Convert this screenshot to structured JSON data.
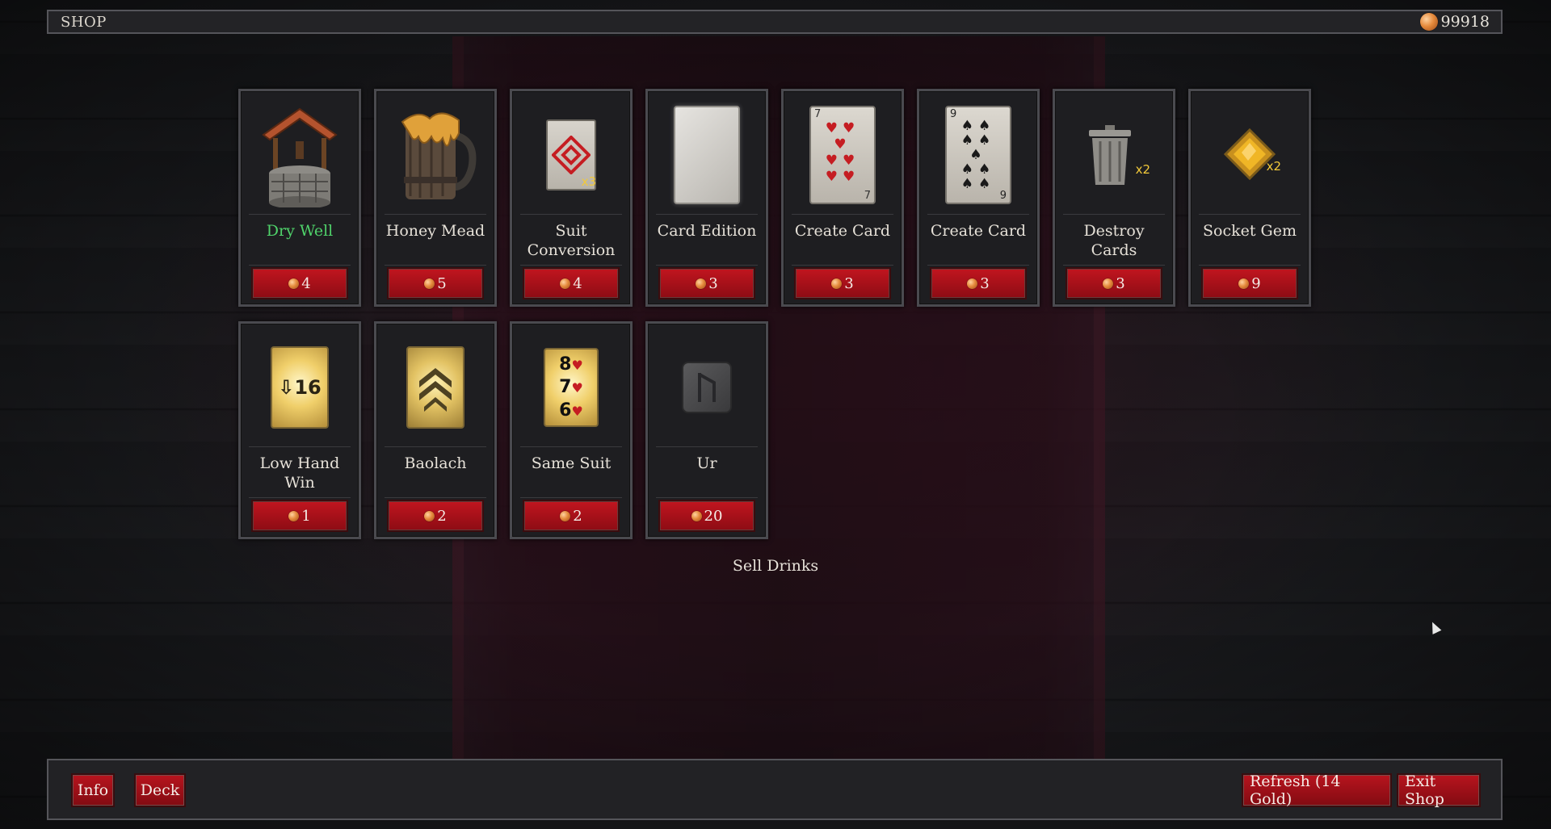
{
  "topbar": {
    "title": "SHOP",
    "gold": "99918"
  },
  "items_row1": [
    {
      "name": "Dry Well",
      "price": "4",
      "icon": "well-icon",
      "highlight": true
    },
    {
      "name": "Honey Mead",
      "price": "5",
      "icon": "mead-mug-icon"
    },
    {
      "name": "Suit Conversion",
      "price": "4",
      "icon": "diamond-suit-card-icon",
      "badge": "x3"
    },
    {
      "name": "Card Edition",
      "price": "3",
      "icon": "blank-card-icon"
    },
    {
      "name": "Create Card",
      "price": "3",
      "icon": "seven-of-hearts-icon",
      "rank": "7"
    },
    {
      "name": "Create Card",
      "price": "3",
      "icon": "nine-of-spades-icon",
      "rank": "9"
    },
    {
      "name": "Destroy Cards",
      "price": "3",
      "icon": "trash-can-icon",
      "badge": "x2"
    },
    {
      "name": "Socket Gem",
      "price": "9",
      "icon": "gem-icon",
      "badge": "x2"
    }
  ],
  "items_row2": [
    {
      "name": "Low Hand Win",
      "price": "1",
      "icon": "low-hand-card-icon",
      "card_text": "16"
    },
    {
      "name": "Baolach",
      "price": "2",
      "icon": "chevron-card-icon"
    },
    {
      "name": "Same Suit",
      "price": "2",
      "icon": "same-suit-card-icon",
      "ranks": [
        "8",
        "7",
        "6"
      ]
    },
    {
      "name": "Ur",
      "price": "20",
      "icon": "rune-stone-icon"
    }
  ],
  "sell_label": "Sell Drinks",
  "bottombar": {
    "info": "Info",
    "deck": "Deck",
    "refresh": "Refresh (14 Gold)",
    "exit": "Exit Shop"
  }
}
